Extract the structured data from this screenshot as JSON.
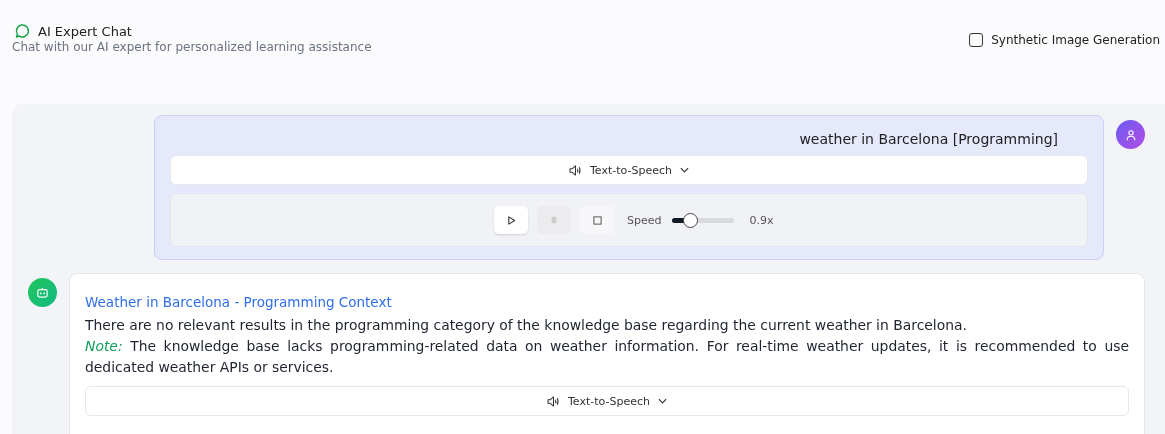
{
  "header": {
    "title": "AI Expert Chat",
    "subtitle": "Chat with our AI expert for personalized learning assistance"
  },
  "option": {
    "label": "Synthetic Image Generation",
    "checked": false
  },
  "messages": [
    {
      "kind": "user",
      "text": "weather in Barcelona [Programming]",
      "tts": {
        "label": "Text-to-Speech",
        "controls": [
          {
            "kind": "play",
            "disabled": false
          },
          {
            "kind": "pause",
            "disabled": true
          },
          {
            "kind": "stop",
            "disabled": false
          }
        ],
        "speed_label": "Speed",
        "level": 0.3,
        "reading": "0.9x"
      }
    },
    {
      "kind": "bot",
      "heading": "Weather in Barcelona - Programming Context",
      "paragraphs": [
        "There are no relevant results in the programming category of the knowledge base regarding the current weather in Barcelona.",
        "*Note:* The knowledge base lacks programming-related data on weather information. For real-time weather updates, it is recommended to use dedicated weather APIs or services."
      ],
      "tts": {
        "label": "Text-to-Speech"
      }
    }
  ]
}
